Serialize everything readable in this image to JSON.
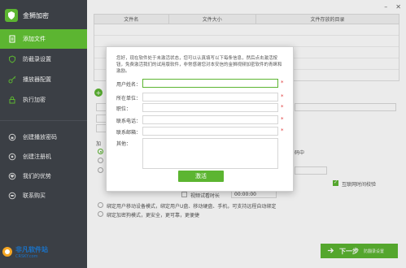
{
  "app": {
    "title": "金狮加密"
  },
  "window_controls": {
    "minimize": "–",
    "close": "✕"
  },
  "sidebar": {
    "items": [
      {
        "label": "添加文件",
        "icon": "file-icon",
        "active": true
      },
      {
        "label": "防截录设置",
        "icon": "shield-icon",
        "active": false
      },
      {
        "label": "播放器配置",
        "icon": "key-icon",
        "active": false
      },
      {
        "label": "执行加密",
        "icon": "lock-icon",
        "active": false
      },
      {
        "label": "创建播放密码",
        "icon": "password-icon",
        "active": false
      },
      {
        "label": "创建注册机",
        "icon": "gear-icon",
        "active": false
      },
      {
        "label": "我们的优势",
        "icon": "heart-icon",
        "active": false
      },
      {
        "label": "联系购买",
        "icon": "cart-icon",
        "active": false
      }
    ]
  },
  "file_table": {
    "columns": [
      "文件名",
      "文件大小",
      "文件存放的目录"
    ]
  },
  "background": {
    "right_partial_text": "码中",
    "checkbox_internet_time": "互联网时间校验",
    "video_duration_label": "视频试看时长",
    "video_duration_value": "00:00:00",
    "bind_usb_label": "绑定用户移动设备模式，绑定用户U盘、移动硬盘、手机，可支持远程自动绑定",
    "bind_pc_label": "绑定加密狗模式，更安全，更可靠，更便捷",
    "next_button": "下一步",
    "next_sub": "防翻录设置"
  },
  "watermark": {
    "cn": "非凡软件站",
    "en": "CRSKY.com"
  },
  "modal": {
    "intro": "您好，现在软件处于未激活状态，您可以认真填写以下每条信息，然后点击激活按钮，免费激活我们的试用版软件，非常感谢您对本安信的金狮视频加密软件的青睐和激励。",
    "fields": [
      {
        "label": "用户姓名：",
        "value": "",
        "required": true
      },
      {
        "label": "所在单位：",
        "value": "",
        "required": true
      },
      {
        "label": "职位：",
        "value": "",
        "required": true
      },
      {
        "label": "联系电话：",
        "value": "",
        "required": true
      },
      {
        "label": "联系邮箱：",
        "value": "",
        "required": true
      }
    ],
    "other_label": "其他：",
    "required_mark": "*",
    "submit": "激活"
  },
  "colors": {
    "accent": "#5cb531",
    "sidebar_bg": "#3b3f45",
    "required": "#e03c3c"
  }
}
